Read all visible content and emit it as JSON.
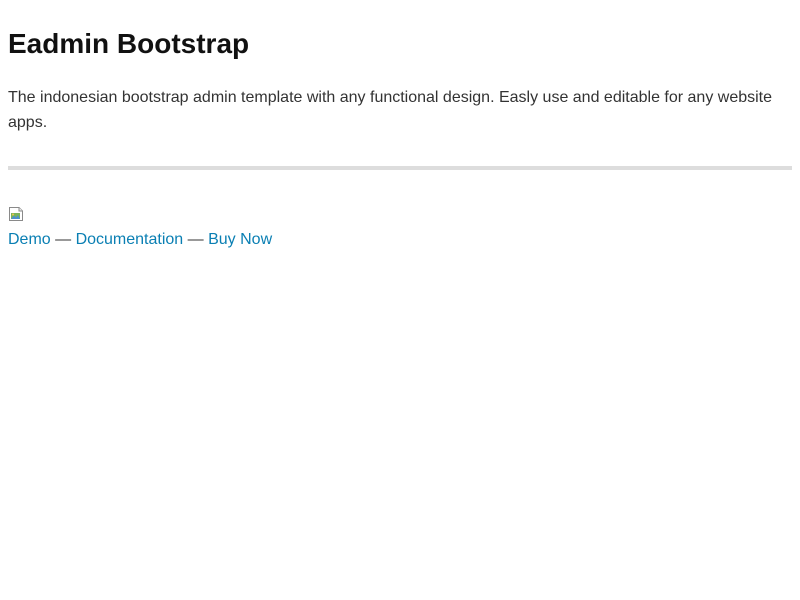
{
  "header": {
    "title": "Eadmin Bootstrap"
  },
  "content": {
    "description": "The indonesian bootstrap admin template with any functional design. Easly use and editable for any website apps."
  },
  "preview_image": {
    "icon": "broken-image-icon"
  },
  "links": {
    "demo": "Demo",
    "documentation": "Documentation",
    "buy_now": "Buy Now",
    "separator": " — "
  },
  "colors": {
    "link": "#0a7fb3",
    "divider": "#dddddd",
    "text": "#333333"
  }
}
